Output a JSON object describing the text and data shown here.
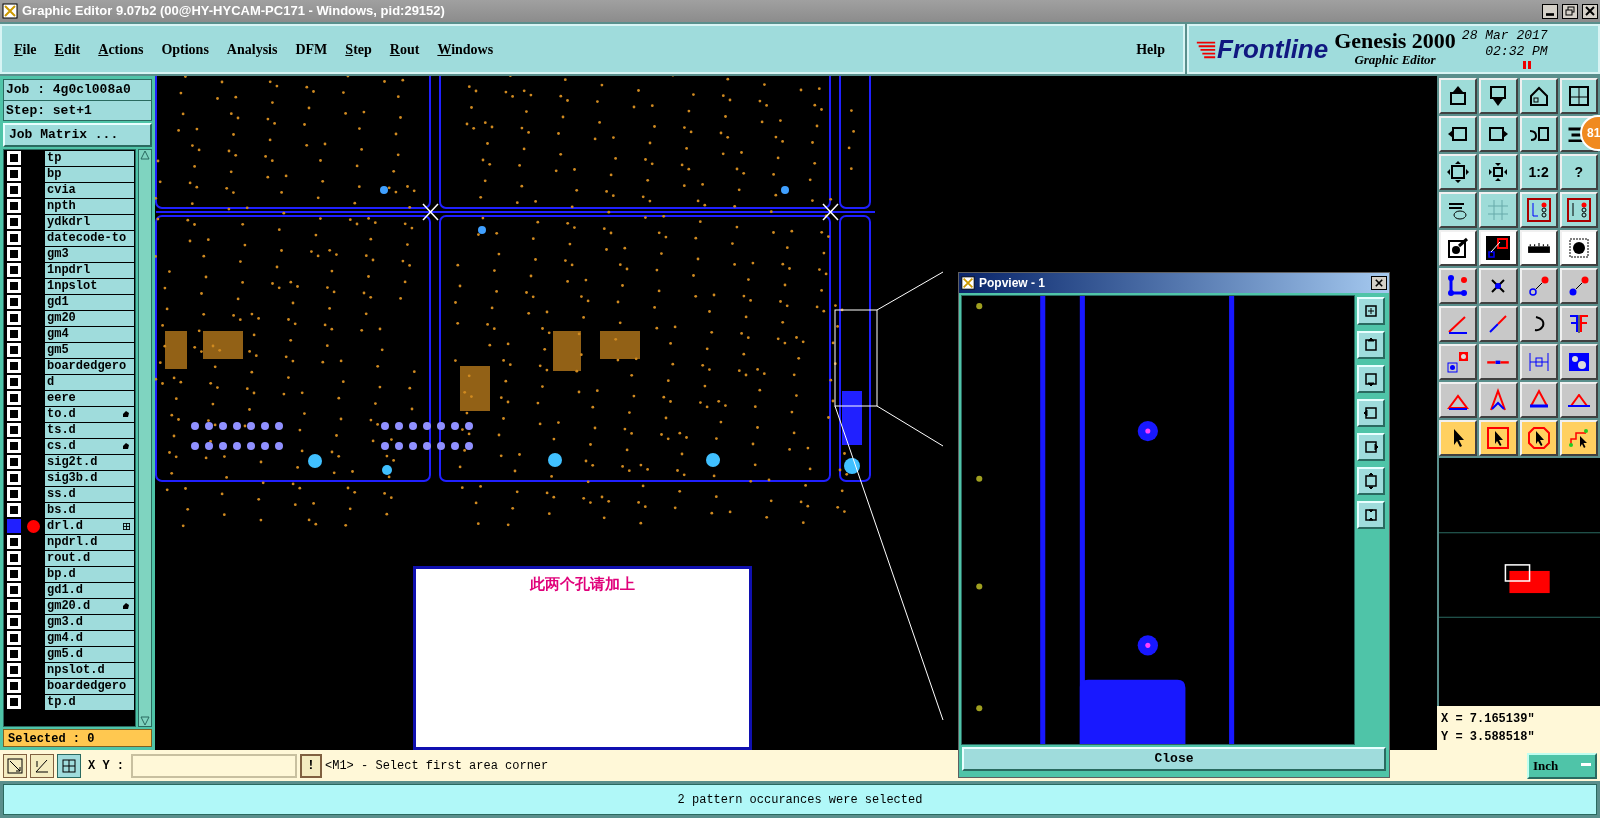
{
  "window": {
    "title": "Graphic Editor 9.07b2 (00@HY-HYCAM-PC171 - Windows, pid:29152)"
  },
  "menu": [
    {
      "label": "File",
      "mnemonic": true
    },
    {
      "label": "Edit",
      "mnemonic": true
    },
    {
      "label": "Actions",
      "mnemonic": true
    },
    {
      "label": "Options",
      "mnemonic": false
    },
    {
      "label": "Analysis",
      "mnemonic": false
    },
    {
      "label": "DFM",
      "mnemonic": false
    },
    {
      "label": "Step",
      "mnemonic": true
    },
    {
      "label": "Rout",
      "mnemonic": true
    },
    {
      "label": "Windows",
      "mnemonic": true
    }
  ],
  "help": "Help",
  "brand": {
    "logo": "Frontline",
    "product": "Genesis 2000",
    "subtitle": "Graphic Editor",
    "date": "28 Mar 2017",
    "time": "02:32 PM"
  },
  "job": "Job : 4g0cl008a0",
  "step": "Step: set+1",
  "job_matrix": "Job Matrix ...",
  "layers": [
    {
      "name": "tp",
      "selected": false,
      "work": false
    },
    {
      "name": "bp",
      "selected": false,
      "work": false
    },
    {
      "name": "cvia",
      "selected": false,
      "work": false
    },
    {
      "name": "npth",
      "selected": false,
      "work": false
    },
    {
      "name": "ydkdrl",
      "selected": false,
      "work": false
    },
    {
      "name": "datecode-to",
      "selected": false,
      "work": false
    },
    {
      "name": "gm3",
      "selected": false,
      "work": false
    },
    {
      "name": "1npdrl",
      "selected": false,
      "work": false
    },
    {
      "name": "1npslot",
      "selected": false,
      "work": false
    },
    {
      "name": "gd1",
      "selected": false,
      "work": false
    },
    {
      "name": "gm20",
      "selected": false,
      "work": false
    },
    {
      "name": "gm4",
      "selected": false,
      "work": false
    },
    {
      "name": "gm5",
      "selected": false,
      "work": false
    },
    {
      "name": "boardedgero",
      "selected": false,
      "work": false
    },
    {
      "name": "d",
      "selected": false,
      "work": false
    },
    {
      "name": "eere",
      "selected": false,
      "work": false
    },
    {
      "name": "to.d",
      "selected": false,
      "work": false,
      "hand": true
    },
    {
      "name": "ts.d",
      "selected": false,
      "work": false
    },
    {
      "name": "cs.d",
      "selected": false,
      "work": false,
      "hand": true
    },
    {
      "name": "sig2t.d",
      "selected": false,
      "work": false
    },
    {
      "name": "sig3b.d",
      "selected": false,
      "work": false
    },
    {
      "name": "ss.d",
      "selected": false,
      "work": false
    },
    {
      "name": "bs.d",
      "selected": false,
      "work": false
    },
    {
      "name": "drl.d",
      "selected": true,
      "work": true,
      "grid": true
    },
    {
      "name": "npdrl.d",
      "selected": false,
      "work": false
    },
    {
      "name": "rout.d",
      "selected": false,
      "work": false
    },
    {
      "name": "bp.d",
      "selected": false,
      "work": false
    },
    {
      "name": "gd1.d",
      "selected": false,
      "work": false
    },
    {
      "name": "gm20.d",
      "selected": false,
      "work": false,
      "hand": true
    },
    {
      "name": "gm3.d",
      "selected": false,
      "work": false
    },
    {
      "name": "gm4.d",
      "selected": false,
      "work": false
    },
    {
      "name": "gm5.d",
      "selected": false,
      "work": false
    },
    {
      "name": "npslot.d",
      "selected": false,
      "work": false
    },
    {
      "name": "boardedgero",
      "selected": false,
      "work": false
    },
    {
      "name": "tp.d",
      "selected": false,
      "work": false
    }
  ],
  "selected_count": "Selected : 0",
  "note": "此两个孔请加上",
  "popview": {
    "title": "Popview - 1",
    "close": "Close"
  },
  "toolbar": [
    {
      "kind": "icon"
    },
    {
      "kind": "icon"
    },
    {
      "kind": "icon"
    },
    {
      "kind": "icon"
    },
    {
      "kind": "icon"
    },
    {
      "kind": "icon"
    },
    {
      "kind": "icon"
    },
    {
      "kind": "icon"
    },
    {
      "kind": "icon"
    },
    {
      "kind": "icon"
    },
    {
      "kind": "text",
      "label": "1:2"
    },
    {
      "kind": "text",
      "label": "?"
    },
    {
      "kind": "icon"
    },
    {
      "kind": "icon"
    },
    {
      "kind": "icon"
    },
    {
      "kind": "icon"
    },
    {
      "kind": "icon"
    },
    {
      "kind": "icon"
    },
    {
      "kind": "icon"
    },
    {
      "kind": "icon"
    },
    {
      "kind": "icon"
    },
    {
      "kind": "icon"
    },
    {
      "kind": "icon"
    },
    {
      "kind": "icon"
    },
    {
      "kind": "icon"
    },
    {
      "kind": "icon"
    },
    {
      "kind": "icon"
    },
    {
      "kind": "icon"
    },
    {
      "kind": "icon"
    },
    {
      "kind": "icon"
    },
    {
      "kind": "icon"
    },
    {
      "kind": "icon"
    },
    {
      "kind": "icon"
    },
    {
      "kind": "icon"
    },
    {
      "kind": "icon"
    },
    {
      "kind": "icon"
    },
    {
      "kind": "icon"
    },
    {
      "kind": "icon"
    },
    {
      "kind": "icon"
    },
    {
      "kind": "icon"
    }
  ],
  "badge": "81",
  "coords": {
    "x": "X = 7.165139\"",
    "y": "Y = 3.588518\""
  },
  "bottom": {
    "xy_label": "X Y :",
    "alert": "!",
    "prompt": "<M1> - Select first area corner",
    "units": "Inch"
  },
  "status": "2 pattern occurances were selected"
}
